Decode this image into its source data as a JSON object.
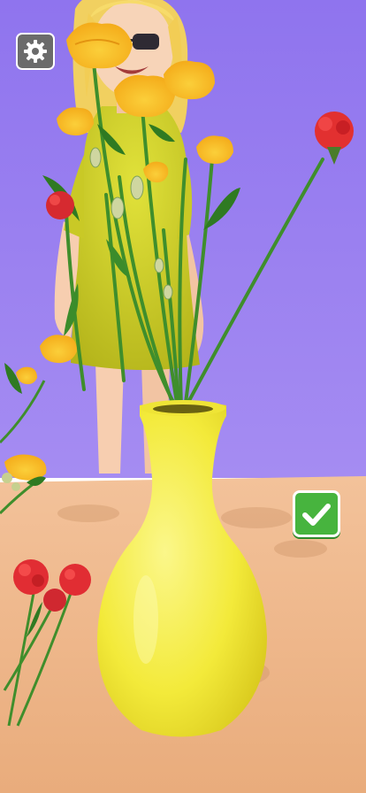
{
  "game": {
    "settings_icon": "gear-icon",
    "confirm_icon": "check-icon"
  },
  "colors": {
    "wall": "#9a7ff0",
    "table": "#f0b98e",
    "vase": "#f4ec3f",
    "confirm_button": "#47b43e",
    "settings_button": "#6b6b6b",
    "yellow_flower": "#f7b81c",
    "red_flower": "#e23030",
    "stem": "#3f8e2c"
  }
}
